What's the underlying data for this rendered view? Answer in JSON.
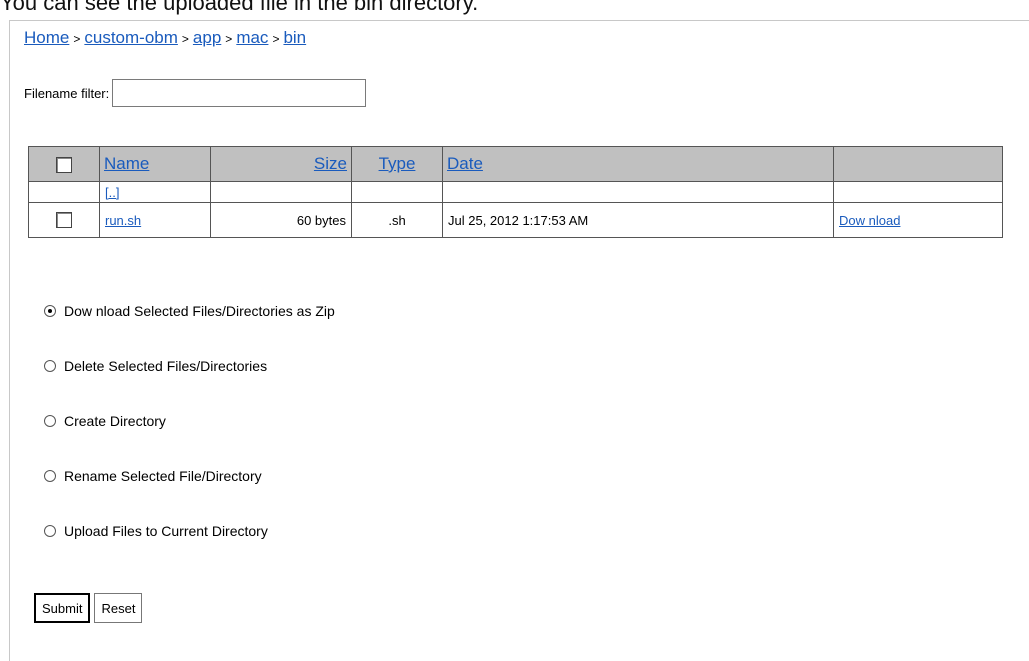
{
  "caption": "You can see the uploaded file in the bin directory.",
  "breadcrumb": {
    "items": [
      "Home",
      "custom-obm",
      "app",
      "mac",
      "bin"
    ],
    "separator": ">"
  },
  "filter": {
    "label": "Filename filter:",
    "value": "",
    "placeholder": ""
  },
  "table": {
    "headers": {
      "name": "Name",
      "size": "Size",
      "type": "Type",
      "date": "Date",
      "action": ""
    },
    "parent_link": "[..]",
    "rows": [
      {
        "name": "run.sh",
        "size": "60 bytes",
        "type": ".sh",
        "date": "Jul 25, 2012 1:17:53 AM",
        "action": "Dow nload"
      }
    ]
  },
  "options": [
    {
      "label": "Dow nload Selected Files/Directories as Zip",
      "checked": true
    },
    {
      "label": "Delete Selected Files/Directories",
      "checked": false
    },
    {
      "label": "Create Directory",
      "checked": false
    },
    {
      "label": "Rename Selected File/Directory",
      "checked": false
    },
    {
      "label": "Upload Files to Current Directory",
      "checked": false
    }
  ],
  "buttons": {
    "submit": "Submit",
    "reset": "Reset"
  },
  "colors": {
    "link": "#1a5bbd",
    "header_bg": "#c0c0c0"
  }
}
